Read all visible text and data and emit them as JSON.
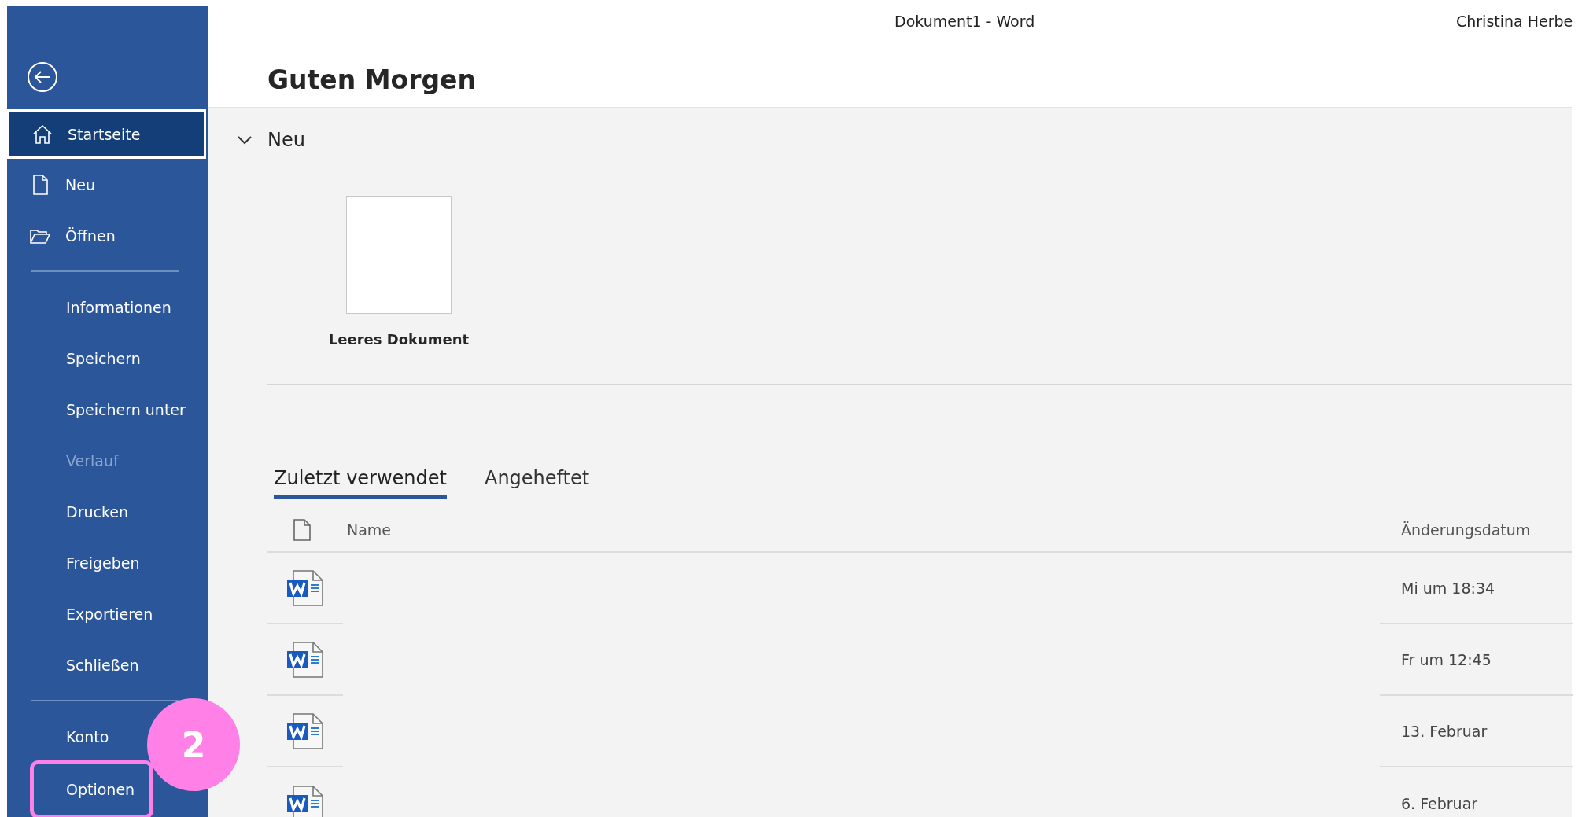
{
  "window": {
    "title": "Dokument1  -  Word",
    "user": "Christina Herbe"
  },
  "sidebar": {
    "items": [
      {
        "label": "Startseite",
        "kind": "icon",
        "selected": true,
        "disabled": false,
        "highlighted": false
      },
      {
        "label": "Neu",
        "kind": "icon",
        "selected": false,
        "disabled": false,
        "highlighted": false
      },
      {
        "label": "Öffnen",
        "kind": "icon",
        "selected": false,
        "disabled": false,
        "highlighted": false
      },
      {
        "kind": "divider"
      },
      {
        "label": "Informationen",
        "kind": "text",
        "selected": false,
        "disabled": false,
        "highlighted": false
      },
      {
        "label": "Speichern",
        "kind": "text",
        "selected": false,
        "disabled": false,
        "highlighted": false
      },
      {
        "label": "Speichern unter",
        "kind": "text",
        "selected": false,
        "disabled": false,
        "highlighted": false
      },
      {
        "label": "Verlauf",
        "kind": "text",
        "selected": false,
        "disabled": true,
        "highlighted": false
      },
      {
        "label": "Drucken",
        "kind": "text",
        "selected": false,
        "disabled": false,
        "highlighted": false
      },
      {
        "label": "Freigeben",
        "kind": "text",
        "selected": false,
        "disabled": false,
        "highlighted": false
      },
      {
        "label": "Exportieren",
        "kind": "text",
        "selected": false,
        "disabled": false,
        "highlighted": false
      },
      {
        "label": "Schließen",
        "kind": "text",
        "selected": false,
        "disabled": false,
        "highlighted": false
      },
      {
        "kind": "divider"
      },
      {
        "label": "Konto",
        "kind": "text",
        "selected": false,
        "disabled": false,
        "highlighted": false
      },
      {
        "label": "Optionen",
        "kind": "text",
        "selected": false,
        "disabled": false,
        "highlighted": true
      }
    ]
  },
  "callout": {
    "number": "2"
  },
  "greeting": "Guten Morgen",
  "new_section": {
    "title": "Neu",
    "expanded": true,
    "templates": [
      {
        "label": "Leeres Dokument"
      }
    ]
  },
  "tabs": [
    {
      "label": "Zuletzt verwendet",
      "selected": true
    },
    {
      "label": "Angeheftet",
      "selected": false
    }
  ],
  "table": {
    "columns": [
      "Name",
      "Änderungsdatum"
    ],
    "rows": [
      {
        "modified": "Mi um 18:34"
      },
      {
        "modified": "Fr um 12:45"
      },
      {
        "modified": "13. Februar"
      },
      {
        "modified": "6. Februar"
      }
    ]
  }
}
